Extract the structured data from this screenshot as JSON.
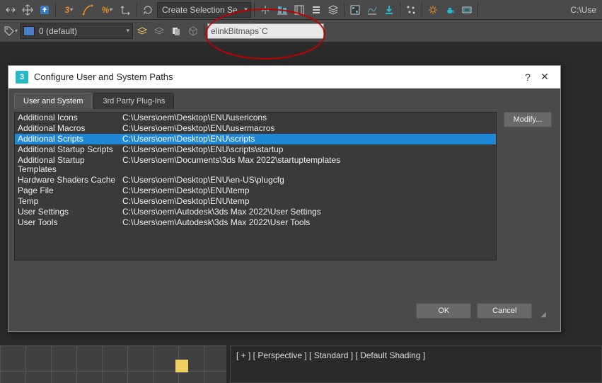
{
  "toolbar": {
    "selection_dropdown": "Create Selection Se",
    "path_label": "C:\\Use"
  },
  "layerbar": {
    "layer_name": "0 (default)",
    "script_input": "elinkBitmaps`C"
  },
  "dialog": {
    "title": "Configure User and System Paths",
    "help": "?",
    "close": "✕",
    "tabs": {
      "user": "User and System",
      "plugins": "3rd Party Plug-Ins"
    },
    "modify": "Modify...",
    "ok": "OK",
    "cancel": "Cancel",
    "paths": [
      {
        "key": "Additional Icons",
        "val": "C:\\Users\\oem\\Desktop\\ENU\\usericons"
      },
      {
        "key": "Additional Macros",
        "val": "C:\\Users\\oem\\Desktop\\ENU\\usermacros"
      },
      {
        "key": "Additional Scripts",
        "val": "C:\\Users\\oem\\Desktop\\ENU\\scripts"
      },
      {
        "key": "Additional Startup Scripts",
        "val": "C:\\Users\\oem\\Desktop\\ENU\\scripts\\startup"
      },
      {
        "key": "Additional Startup Templates",
        "val": "C:\\Users\\oem\\Documents\\3ds Max 2022\\startuptemplates"
      },
      {
        "key": "Hardware Shaders Cache",
        "val": "C:\\Users\\oem\\Desktop\\ENU\\en-US\\plugcfg"
      },
      {
        "key": "Page File",
        "val": "C:\\Users\\oem\\Desktop\\ENU\\temp"
      },
      {
        "key": "Temp",
        "val": "C:\\Users\\oem\\Desktop\\ENU\\temp"
      },
      {
        "key": "User Settings",
        "val": "C:\\Users\\oem\\Autodesk\\3ds Max 2022\\User Settings"
      },
      {
        "key": "User Tools",
        "val": "C:\\Users\\oem\\Autodesk\\3ds Max 2022\\User Tools"
      }
    ],
    "selected_index": 2
  },
  "viewport": {
    "status": "[ + ] [ Perspective ] [ Standard ] [ Default Shading ]"
  },
  "icons": {
    "app": "3"
  }
}
